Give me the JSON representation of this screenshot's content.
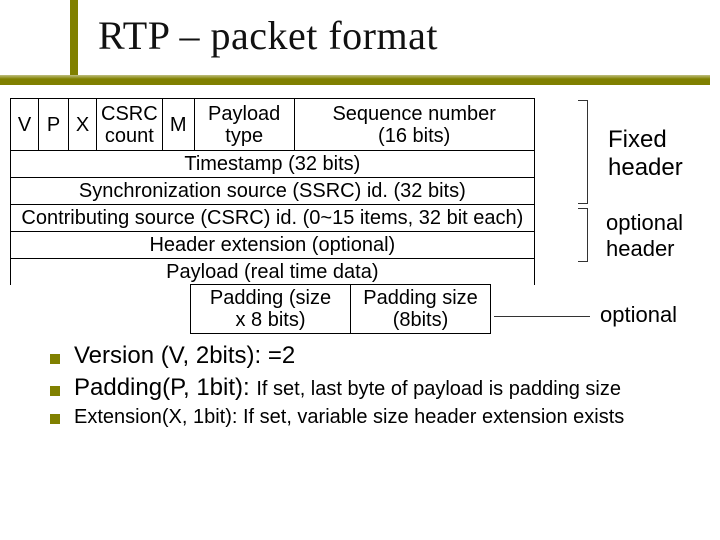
{
  "title": "RTP – packet format",
  "packet": {
    "row1": {
      "v": "V",
      "p": "P",
      "x": "X",
      "csrc": "CSRC\ncount",
      "m": "M",
      "ptype": "Payload\ntype",
      "seq": "Sequence number\n(16 bits)"
    },
    "timestamp": "Timestamp (32 bits)",
    "ssrc": "Synchronization source (SSRC) id. (32 bits)",
    "csrc_list": "Contributing source (CSRC) id. (0~15 items, 32 bit each)",
    "hdr_ext": "Header extension (optional)",
    "payload": "Payload (real time data)",
    "padbody": "Padding (size\nx 8 bits)",
    "padsize": "Padding size\n(8bits)"
  },
  "annotations": {
    "fixed": "Fixed\nheader",
    "optional_header": "optional\nheader",
    "optional": "optional"
  },
  "bullets": {
    "version_main": "Version (V, 2bits): =2",
    "padding_main": "Padding(P, 1bit): ",
    "padding_sub": "If set, last byte of payload is padding size",
    "extension": "Extension(X, 1bit): If set, variable size header extension exists"
  }
}
